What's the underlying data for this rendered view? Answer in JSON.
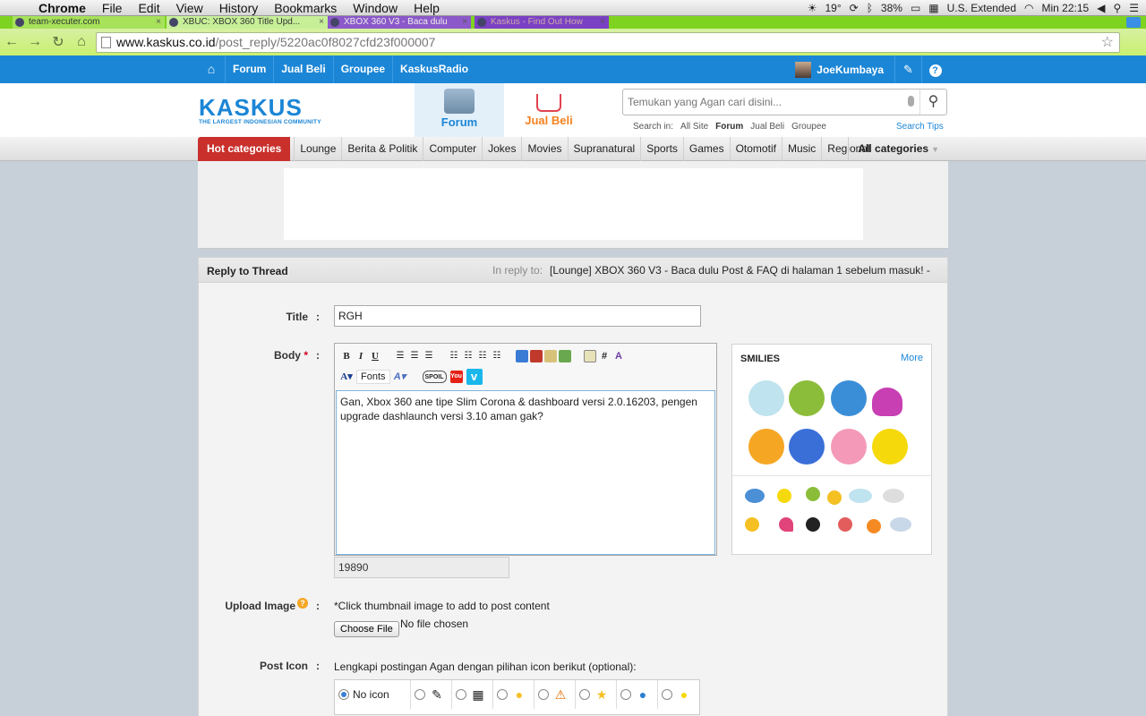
{
  "menubar": {
    "app": "Chrome",
    "items": [
      "File",
      "Edit",
      "View",
      "History",
      "Bookmarks",
      "Window",
      "Help"
    ],
    "weather": "19°",
    "battery": "38%",
    "input_source": "U.S. Extended",
    "clock": "Min 22:15"
  },
  "tabs": [
    {
      "title": "team-xecuter.com"
    },
    {
      "title": "XBUC: XBOX 360 Title Upd..."
    },
    {
      "title": "XBOX 360 V3 - Baca dulu"
    },
    {
      "title": "Kaskus - Find Out How"
    }
  ],
  "address": {
    "domain": "www.kaskus.co.id",
    "path": "/post_reply/5220ac0f8027cfd23f000007"
  },
  "kaskus_nav": {
    "links": [
      "Forum",
      "Jual Beli",
      "Groupee",
      "KaskusRadio"
    ],
    "username": "JoeKumbaya",
    "help": "?"
  },
  "header": {
    "logo_word": "KASKUS",
    "logo_tagline": "THE LARGEST INDONESIAN COMMUNITY",
    "tab_forum": "Forum",
    "tab_jualbeli": "Jual Beli",
    "search_placeholder": "Temukan yang Agan cari disini...",
    "search_in_label": "Search in:",
    "search_in": [
      "All Site",
      "Forum",
      "Jual Beli",
      "Groupee"
    ],
    "search_tips": "Search Tips"
  },
  "categories": {
    "hot": "Hot categories",
    "items": [
      "Lounge",
      "Berita & Politik",
      "Computer",
      "Jokes",
      "Movies",
      "Supranatural",
      "Sports",
      "Games",
      "Otomotif",
      "Music",
      "Regional"
    ],
    "all": "All categories"
  },
  "reply": {
    "heading": "Reply to Thread",
    "in_reply_label": "In reply to:",
    "thread_title": "[Lounge] XBOX 360 V3 - Baca dulu Post & FAQ di halaman 1 sebelum masuk! -",
    "title_label": "Title",
    "title_value": "RGH",
    "body_label": "Body",
    "required_mark": "*",
    "body_value": "Gan, Xbox 360 ane tipe Slim Corona & dashboard versi 2.0.16203, pengen upgrade dashlaunch versi 3.10 aman gak?",
    "char_count": "19890",
    "fonts_button": "Fonts",
    "upload_label": "Upload Image",
    "upload_note": "*Click thumbnail image to add to post content",
    "choose_file": "Choose File",
    "no_file": "No file chosen",
    "post_icon_label": "Post Icon",
    "post_icon_note": "Lengkapi postingan Agan dengan pilihan icon berikut (optional):",
    "no_icon": "No icon",
    "colon": ":"
  },
  "smilies": {
    "heading": "SMILIES",
    "more": "More"
  }
}
